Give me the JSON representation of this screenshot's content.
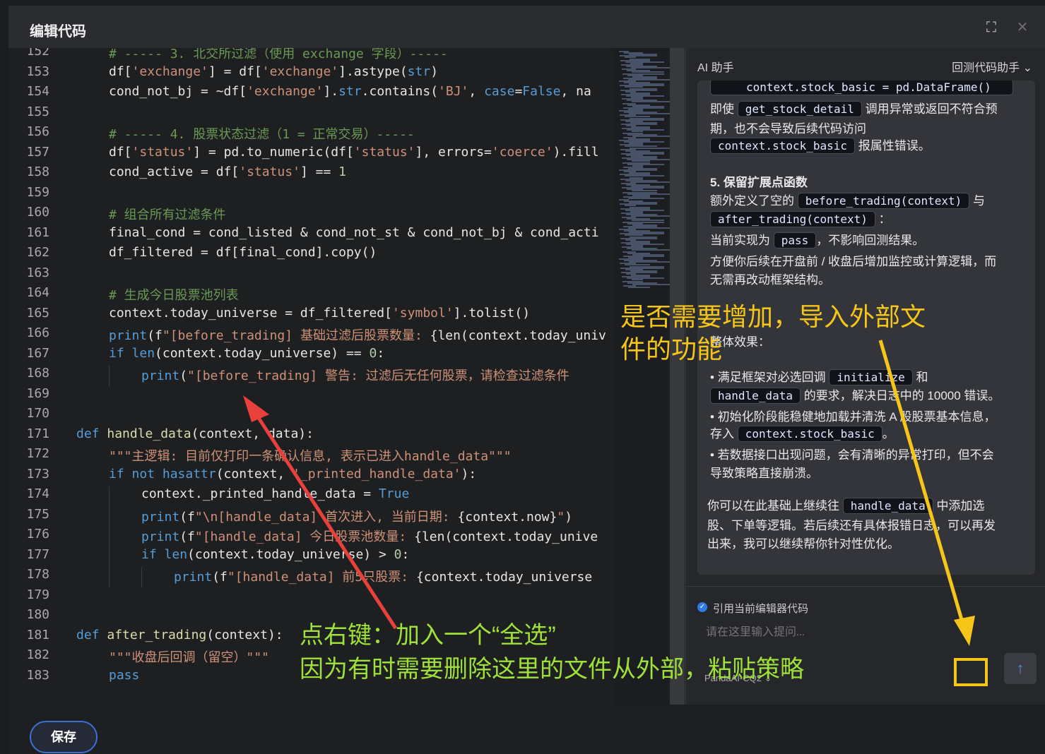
{
  "window": {
    "title": "编辑代码",
    "fullscreen_icon": "⛶",
    "close_icon": "✕"
  },
  "editor": {
    "line_numbers": [
      "152",
      "153",
      "154",
      "155",
      "156",
      "157",
      "158",
      "159",
      "160",
      "161",
      "162",
      "163",
      "164",
      "165",
      "166",
      "167",
      "168",
      "169",
      "170",
      "171",
      "172",
      "173",
      "174",
      "175",
      "176",
      "177",
      "178",
      "179",
      "180",
      "181",
      "182",
      "183"
    ],
    "lines": [
      {
        "indent": 1,
        "parts": [
          [
            "c",
            "# ----- 3. 北交所过滤（使用 exchange 字段）-----"
          ]
        ]
      },
      {
        "indent": 1,
        "parts": [
          [
            "t",
            "df["
          ],
          [
            "s",
            "'exchange'"
          ],
          [
            "t",
            "] = df["
          ],
          [
            "s",
            "'exchange'"
          ],
          [
            "t",
            "].astype("
          ],
          [
            "k",
            "str"
          ],
          [
            "t",
            ")"
          ]
        ]
      },
      {
        "indent": 1,
        "parts": [
          [
            "t",
            "cond_not_bj = ~df["
          ],
          [
            "s",
            "'exchange'"
          ],
          [
            "t",
            "]."
          ],
          [
            "k",
            "str"
          ],
          [
            "t",
            ".contains("
          ],
          [
            "s",
            "'BJ'"
          ],
          [
            "t",
            ", "
          ],
          [
            "k",
            "case"
          ],
          [
            "t",
            "="
          ],
          [
            "k",
            "False"
          ],
          [
            "t",
            ", na"
          ]
        ]
      },
      {
        "indent": 0,
        "parts": []
      },
      {
        "indent": 1,
        "parts": [
          [
            "c",
            "# ----- 4. 股票状态过滤（1 = 正常交易）-----"
          ]
        ]
      },
      {
        "indent": 1,
        "parts": [
          [
            "t",
            "df["
          ],
          [
            "s",
            "'status'"
          ],
          [
            "t",
            "] = pd.to_numeric(df["
          ],
          [
            "s",
            "'status'"
          ],
          [
            "t",
            "], errors="
          ],
          [
            "s",
            "'coerce'"
          ],
          [
            "t",
            ").fill"
          ]
        ]
      },
      {
        "indent": 1,
        "parts": [
          [
            "t",
            "cond_active = df["
          ],
          [
            "s",
            "'status'"
          ],
          [
            "t",
            "] == "
          ],
          [
            "n",
            "1"
          ]
        ]
      },
      {
        "indent": 0,
        "parts": []
      },
      {
        "indent": 1,
        "parts": [
          [
            "c",
            "# 组合所有过滤条件"
          ]
        ]
      },
      {
        "indent": 1,
        "parts": [
          [
            "t",
            "final_cond = cond_listed & cond_not_st & cond_not_bj & cond_acti"
          ]
        ]
      },
      {
        "indent": 1,
        "parts": [
          [
            "t",
            "df_filtered = df[final_cond].copy()"
          ]
        ]
      },
      {
        "indent": 0,
        "parts": []
      },
      {
        "indent": 1,
        "parts": [
          [
            "c",
            "# 生成今日股票池列表"
          ]
        ]
      },
      {
        "indent": 1,
        "parts": [
          [
            "t",
            "context.today_universe = df_filtered["
          ],
          [
            "s",
            "'symbol'"
          ],
          [
            "t",
            "].tolist()"
          ]
        ]
      },
      {
        "indent": 1,
        "parts": [
          [
            "k",
            "print"
          ],
          [
            "t",
            "(f"
          ],
          [
            "s",
            "\"[before_trading] 基础过滤后股票数量: "
          ],
          [
            "t",
            "{len(context.today_univ"
          ]
        ]
      },
      {
        "indent": 1,
        "parts": [
          [
            "k",
            "if "
          ],
          [
            "k",
            "len"
          ],
          [
            "t",
            "(context.today_universe) == "
          ],
          [
            "n",
            "0"
          ],
          [
            "t",
            ":"
          ]
        ]
      },
      {
        "indent": 2,
        "parts": [
          [
            "k",
            "print"
          ],
          [
            "t",
            "("
          ],
          [
            "s",
            "\"[before_trading] 警告: 过滤后无任何股票，请检查过滤条件"
          ]
        ]
      },
      {
        "indent": 0,
        "parts": []
      },
      {
        "indent": 0,
        "parts": []
      },
      {
        "indent": 0,
        "parts": [
          [
            "k",
            "def "
          ],
          [
            "f",
            "handle_data"
          ],
          [
            "t",
            "(context, data):"
          ]
        ]
      },
      {
        "indent": 1,
        "parts": [
          [
            "s",
            "\"\"\"主逻辑: 目前仅打印一条确认信息, 表示已进入handle_data\"\"\""
          ]
        ]
      },
      {
        "indent": 1,
        "parts": [
          [
            "k",
            "if not "
          ],
          [
            "k",
            "hasattr"
          ],
          [
            "t",
            "(context, "
          ],
          [
            "s",
            "'_printed_handle_data'"
          ],
          [
            "t",
            "):"
          ]
        ]
      },
      {
        "indent": 2,
        "parts": [
          [
            "t",
            "context._printed_handle_data = "
          ],
          [
            "k",
            "True"
          ]
        ]
      },
      {
        "indent": 2,
        "parts": [
          [
            "k",
            "print"
          ],
          [
            "t",
            "(f"
          ],
          [
            "s",
            "\"\\n[handle_data] 首次进入, 当前日期: "
          ],
          [
            "t",
            "{context.now}"
          ],
          [
            "s",
            "\""
          ],
          [
            "t",
            ")"
          ]
        ]
      },
      {
        "indent": 2,
        "parts": [
          [
            "k",
            "print"
          ],
          [
            "t",
            "(f"
          ],
          [
            "s",
            "\"[handle_data] 今日股票池数量: "
          ],
          [
            "t",
            "{len(context.today_unive"
          ]
        ]
      },
      {
        "indent": 2,
        "parts": [
          [
            "k",
            "if "
          ],
          [
            "k",
            "len"
          ],
          [
            "t",
            "(context.today_universe) > "
          ],
          [
            "n",
            "0"
          ],
          [
            "t",
            ":"
          ]
        ]
      },
      {
        "indent": 3,
        "parts": [
          [
            "k",
            "print"
          ],
          [
            "t",
            "(f"
          ],
          [
            "s",
            "\"[handle_data] 前5只股票: "
          ],
          [
            "t",
            "{context.today_universe"
          ]
        ]
      },
      {
        "indent": 0,
        "parts": []
      },
      {
        "indent": 0,
        "parts": []
      },
      {
        "indent": 0,
        "parts": [
          [
            "k",
            "def "
          ],
          [
            "f",
            "after_trading"
          ],
          [
            "t",
            "(context):"
          ]
        ]
      },
      {
        "indent": 1,
        "parts": [
          [
            "s",
            "\"\"\"收盘后回调（留空）\"\"\""
          ]
        ]
      },
      {
        "indent": 1,
        "parts": [
          [
            "k",
            "pass"
          ]
        ]
      }
    ]
  },
  "ai": {
    "title": "AI 助手",
    "mode": "回测代码助手",
    "mode_caret": "⌄",
    "card": {
      "l1_code": "context.stock_basic = pd.DataFrame()",
      "l2_pre": "即使",
      "l2_code": "get_stock_detail",
      "l2_post": "调用异常或返回不符合预",
      "l3": "期，也不会导致后续代码访问",
      "l4_code": "context.stock_basic",
      "l4_post": "报属性错误。",
      "h5": "5. 保留扩展点函数",
      "l6_pre": "额外定义了空的",
      "l6_code": "before_trading(context)",
      "l6_post": "与",
      "l7_code": "after_trading(context)",
      "l7_post": "：",
      "l8_pre": "当前实现为",
      "l8_code": "pass",
      "l8_post": "，不影响回测结果。",
      "l9": "方便你后续在开盘前 / 收盘后增加监控或计算逻辑，而",
      "l10": "无需再改动框架结构。",
      "overall": "整体效果：",
      "b1_pre": "•  满足框架对必选回调",
      "b1_code": "initialize",
      "b1_post": "和",
      "b1b_code": "handle_data",
      "b1b_post": "的要求，解决日志中的 10000 错误。",
      "b2": "•  初始化阶段能稳健地加载并清洗 A 股股票基本信息，",
      "b2b_pre": "存入",
      "b2b_code": "context.stock_basic",
      "b2b_post": "。",
      "b3": "•  若数据接口出现问题，会有清晰的异常打印，但不会",
      "b3b": "导致策略直接崩溃。",
      "f1_pre": "你可以在此基础上继续往",
      "f1_code": "handle_data",
      "f1_post": "中添加选",
      "f2": "股、下单等逻辑。若后续还有具体报错日志，可以再发",
      "f3": "出来，我可以继续帮你针对性优化。"
    },
    "checkbox_label": "引用当前编辑器代码",
    "input_placeholder": "请在这里输入提问...",
    "model": "PandaAI-CQ2 ⌄",
    "send_icon": "↑"
  },
  "footer": {
    "save_label": "保存"
  },
  "annotations": {
    "green_line1": "点右键：加入一个“全选”",
    "green_line2": "因为有时需要删除这里的文件从外部，粘贴策略",
    "yellow_line1": "是否需要增加，导入外部文",
    "yellow_line2": "件的功能"
  },
  "colors": {
    "keyword": "#569cd6",
    "string": "#ce9178",
    "comment": "#6a9955",
    "number": "#b5cea8",
    "function": "#dcdcaa",
    "text": "#e6e6e6",
    "annot_green": "#9ee13a",
    "annot_yellow": "#f5c518",
    "arrow_red": "#e8413b"
  }
}
